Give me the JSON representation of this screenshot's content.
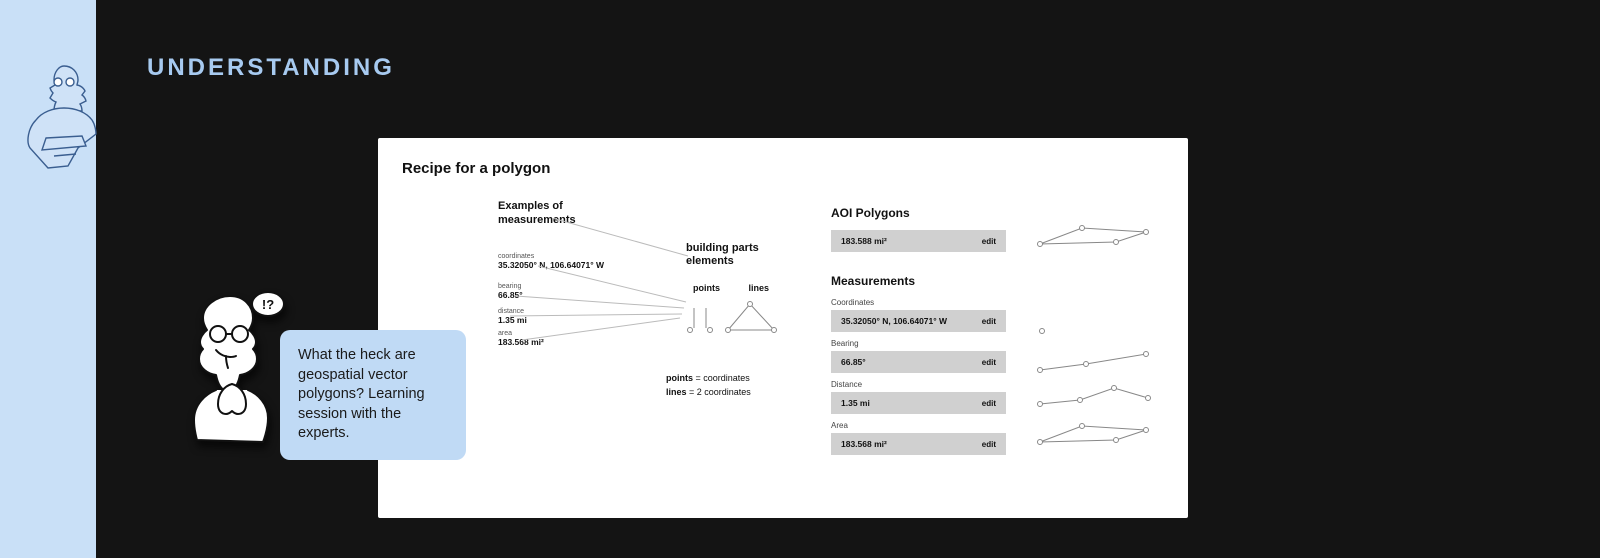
{
  "section_title": "UNDERSTANDING",
  "speech_text": "What the heck are geospatial vector polygons? Learning session with the experts.",
  "card": {
    "title": "Recipe for a polygon",
    "examples": {
      "heading_l1": "Examples of",
      "heading_l2": "measurements",
      "coordinates": {
        "label": "coordinates",
        "value": "35.32050° N, 106.64071° W"
      },
      "bearing": {
        "label": "bearing",
        "value": "66.85°"
      },
      "distance": {
        "label": "distance",
        "value": "1.35 mi"
      },
      "area": {
        "label": "area",
        "value": "183.568 mi²"
      }
    },
    "building_parts": {
      "heading_l1": "building parts",
      "heading_l2": "elements",
      "label_points": "points",
      "label_lines": "lines",
      "eq_points_lhs": "points",
      "eq_points_rhs": " = coordinates",
      "eq_lines_lhs": "lines",
      "eq_lines_rhs": " = 2 coordinates"
    },
    "aoi": {
      "heading": "AOI Polygons",
      "value": "183.588 mi²",
      "edit": "edit"
    },
    "measurements": {
      "heading": "Measurements",
      "coordinates": {
        "label": "Coordinates",
        "value": "35.32050° N, 106.64071° W",
        "edit": "edit"
      },
      "bearing": {
        "label": "Bearing",
        "value": "66.85°",
        "edit": "edit"
      },
      "distance": {
        "label": "Distance",
        "value": "1.35 mi",
        "edit": "edit"
      },
      "area": {
        "label": "Area",
        "value": "183.568 mi²",
        "edit": "edit"
      }
    }
  }
}
